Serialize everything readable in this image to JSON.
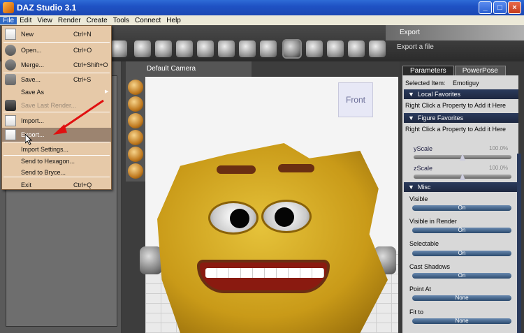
{
  "window": {
    "title": "DAZ Studio 3.1",
    "min": "_",
    "max": "□",
    "close": "×"
  },
  "menubar": [
    "File",
    "Edit",
    "View",
    "Render",
    "Create",
    "Tools",
    "Connect",
    "Help"
  ],
  "toolbar": {
    "tooltip_title": "Export",
    "tooltip_desc": "Export a file"
  },
  "viewport": {
    "camera": "Default Camera",
    "cube_label": "Front"
  },
  "file_menu": {
    "new": {
      "label": "New",
      "shortcut": "Ctrl+N"
    },
    "open": {
      "label": "Open...",
      "shortcut": "Ctrl+O"
    },
    "merge": {
      "label": "Merge...",
      "shortcut": "Ctrl+Shift+O"
    },
    "save": {
      "label": "Save...",
      "shortcut": "Ctrl+S"
    },
    "save_as": {
      "label": "Save As"
    },
    "save_last_render": {
      "label": "Save Last Render..."
    },
    "import": {
      "label": "Import..."
    },
    "export": {
      "label": "Export..."
    },
    "import_settings": {
      "label": "Import Settings..."
    },
    "send_hexagon": {
      "label": "Send to Hexagon..."
    },
    "send_bryce": {
      "label": "Send to Bryce..."
    },
    "exit": {
      "label": "Exit",
      "shortcut": "Ctrl+Q"
    }
  },
  "right_panel": {
    "tabs": [
      "Parameters",
      "PowerPose"
    ],
    "selected_label": "Selected Item:",
    "selected_value": "Emotiguy",
    "local_favorites": "Local Favorites",
    "figure_favorites": "Figure Favorites",
    "fav_note": "Right Click a Property to Add it Here",
    "yscale": {
      "label": "yScale",
      "value": "100.0%"
    },
    "zscale": {
      "label": "zScale",
      "value": "100.0%"
    },
    "misc": "Misc",
    "props": [
      {
        "label": "Visible",
        "value": "On"
      },
      {
        "label": "Visible in Render",
        "value": "On"
      },
      {
        "label": "Selectable",
        "value": "On"
      },
      {
        "label": "Cast Shadows",
        "value": "On"
      },
      {
        "label": "Point At",
        "value": "None"
      },
      {
        "label": "Fit to",
        "value": "None"
      }
    ]
  },
  "colors": {
    "menu_bg": "#e6c9a8",
    "highlight": "#9c8470",
    "arrow": "#e01010"
  }
}
